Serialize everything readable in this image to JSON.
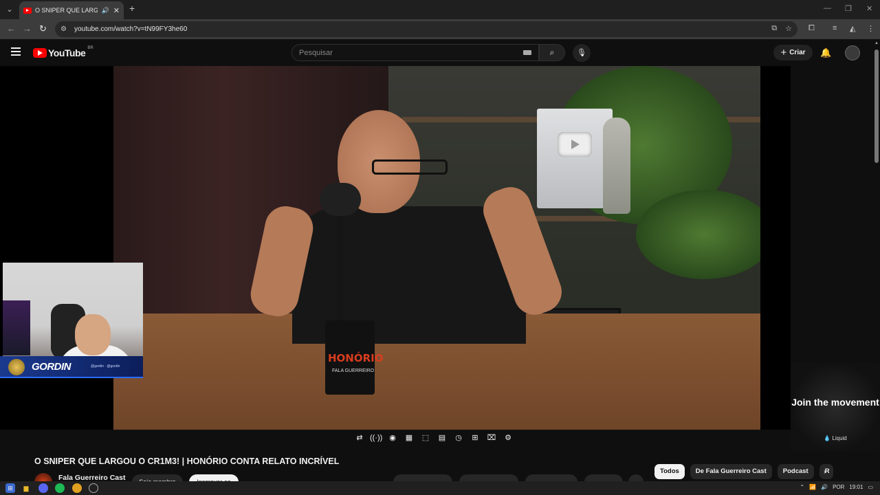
{
  "browser": {
    "tab_title": "O SNIPER QUE LARGOU O CR",
    "url": "youtube.com/watch?v=tN99FY3he60"
  },
  "youtube": {
    "logo_text": "YouTube",
    "country_code": "BR",
    "search_placeholder": "Pesquisar",
    "create_label": "Criar"
  },
  "video": {
    "mug_label": "HONÓRIO",
    "mug_sub": "FALA GUERREIRO",
    "streamer_name": "GORDIN",
    "streamer_handles": "@gordin · @gordin",
    "title": "O SNIPER QUE LARGOU O CR1M3! | HONÓRIO CONTA RELATO INCRÍVEL",
    "channel_name": "Fala Guerreiro Cast",
    "join_label": "Seja membro",
    "subscribe_label": "Inscrever-se"
  },
  "ad": {
    "headline": "Join the movement",
    "brand": "Liquid"
  },
  "chips": [
    "Todos",
    "De Fala Guerreiro Cast",
    "Podcast",
    "R"
  ],
  "taskbar": {
    "language": "POR",
    "time": "19:01"
  }
}
